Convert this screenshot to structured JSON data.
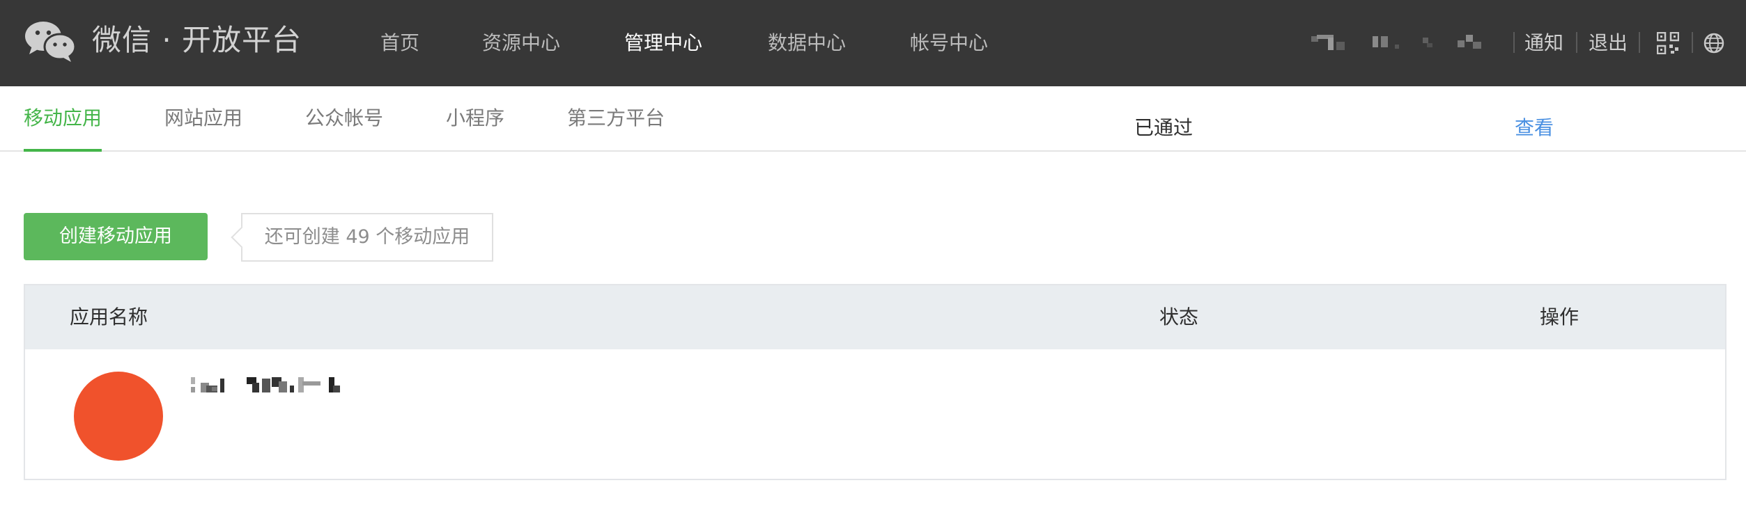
{
  "header": {
    "logo_icon": "wechat-logo-icon",
    "brand_title": "微信 · 开放平台",
    "nav": [
      {
        "label": "首页",
        "active": false
      },
      {
        "label": "资源中心",
        "active": false
      },
      {
        "label": "管理中心",
        "active": true
      },
      {
        "label": "数据中心",
        "active": false
      },
      {
        "label": "帐号中心",
        "active": false
      }
    ],
    "notify_label": "通知",
    "logout_label": "退出",
    "qr_icon": "qrcode-icon",
    "globe_icon": "globe-icon"
  },
  "subnav": {
    "tabs": [
      {
        "label": "移动应用",
        "active": true
      },
      {
        "label": "网站应用",
        "active": false
      },
      {
        "label": "公众帐号",
        "active": false
      },
      {
        "label": "小程序",
        "active": false
      },
      {
        "label": "第三方平台",
        "active": false
      }
    ]
  },
  "actions": {
    "create_label": "创建移动应用",
    "remaining_tip": "还可创建 49 个移动应用"
  },
  "table": {
    "headers": {
      "name": "应用名称",
      "status": "状态",
      "action": "操作"
    },
    "rows": [
      {
        "status": "已通过",
        "action": "查看",
        "avatar_color": "#f0522c"
      }
    ]
  },
  "colors": {
    "accent_green": "#44b549",
    "button_green": "#5cb85c",
    "link_blue": "#4a90e2",
    "topbar_bg": "#373737"
  }
}
